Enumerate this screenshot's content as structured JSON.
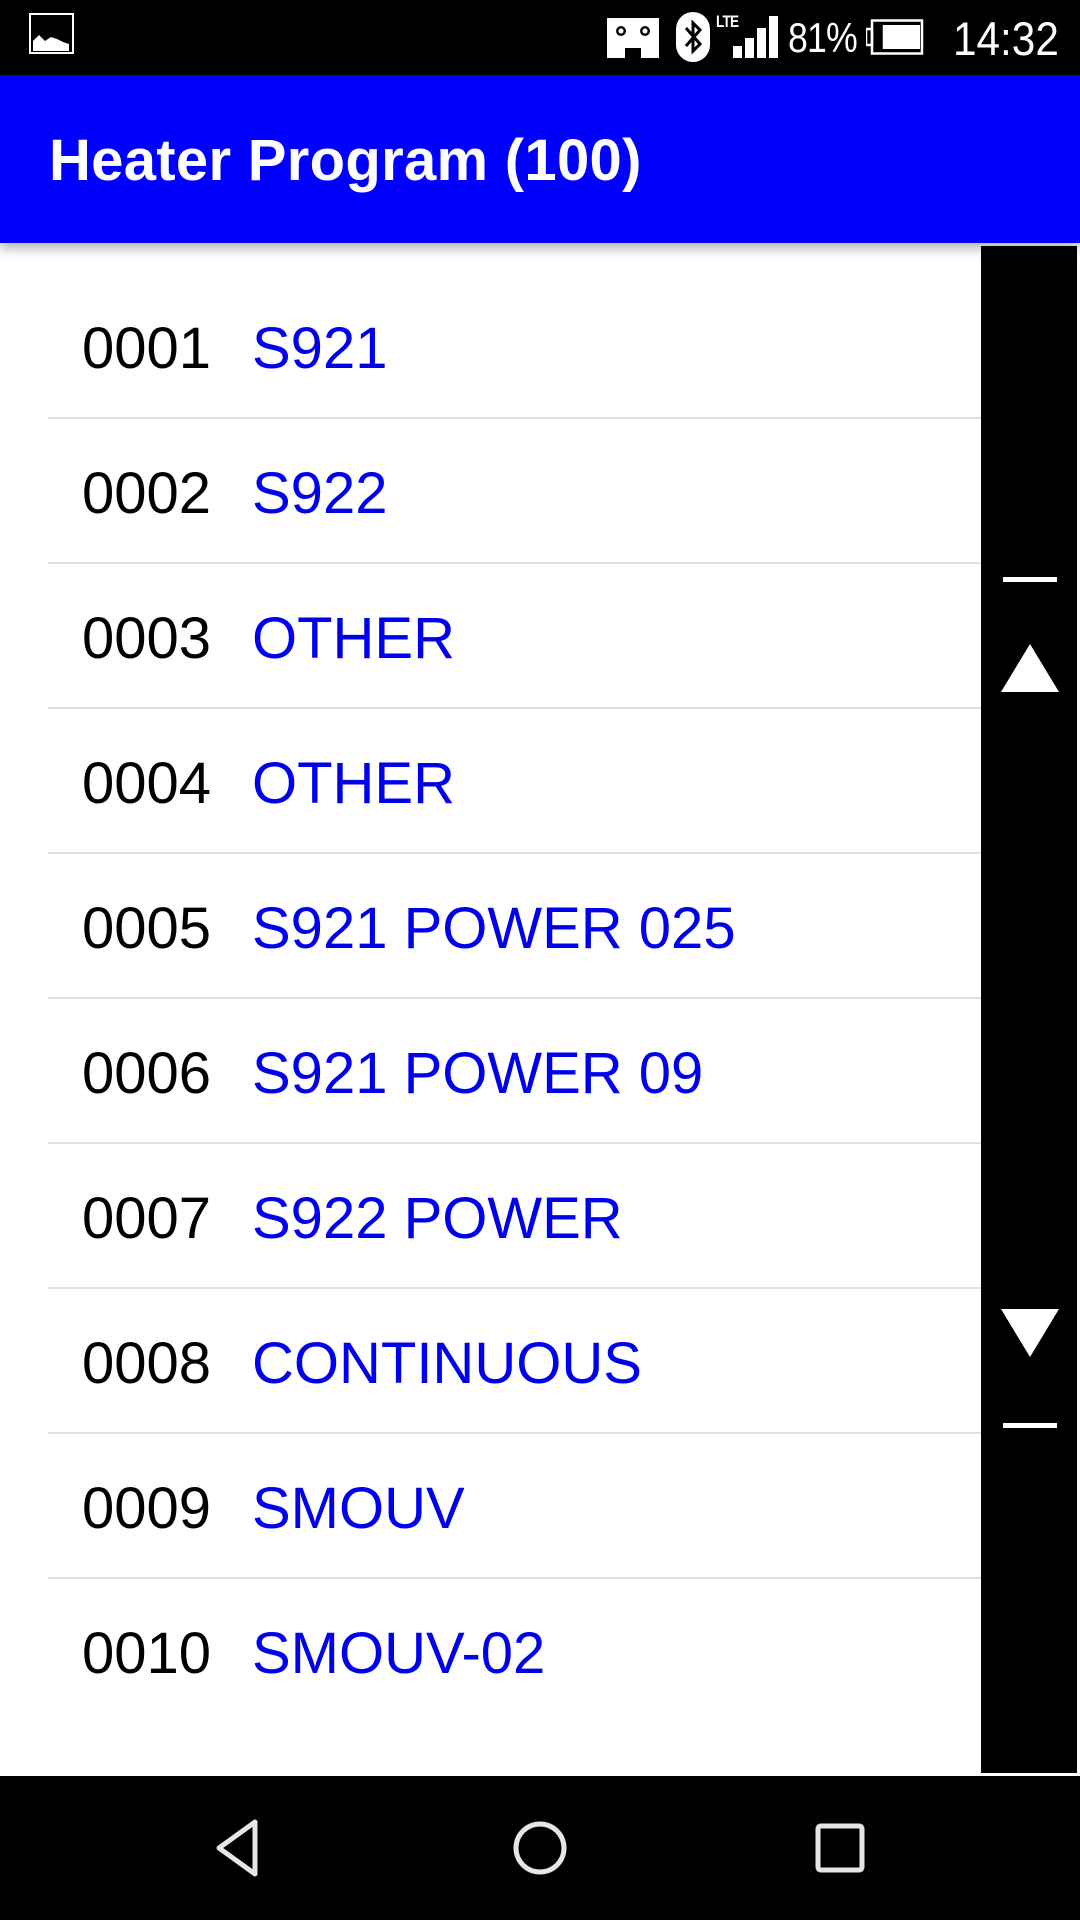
{
  "status_bar": {
    "icons": [
      "gallery-notification-icon",
      "vr-headset-icon",
      "bluetooth-icon",
      "lte-signal-icon",
      "battery-icon"
    ],
    "network_label": "LTE",
    "battery_percent": "81%",
    "battery_level": 0.81,
    "time": "14:32"
  },
  "app_bar": {
    "title": "Heater Program (100)",
    "background_color": "#0000FF"
  },
  "list": {
    "number_color": "#000000",
    "name_color": "#0000EE",
    "items": [
      {
        "number": "0001",
        "name": "S921"
      },
      {
        "number": "0002",
        "name": "S922"
      },
      {
        "number": "0003",
        "name": "OTHER"
      },
      {
        "number": "0004",
        "name": "OTHER"
      },
      {
        "number": "0005",
        "name": "S921 POWER 025"
      },
      {
        "number": "0006",
        "name": "S921 POWER 09"
      },
      {
        "number": "0007",
        "name": "S922 POWER"
      },
      {
        "number": "0008",
        "name": "CONTINUOUS"
      },
      {
        "number": "0009",
        "name": "SMOUV"
      },
      {
        "number": "0010",
        "name": "SMOUV-02"
      }
    ]
  },
  "scrollbar": {
    "icons": [
      "scroll-to-top-icon",
      "scroll-up-icon",
      "scroll-down-icon",
      "scroll-to-bottom-icon"
    ]
  },
  "nav_bar": {
    "buttons": [
      "back",
      "home",
      "recents"
    ]
  }
}
